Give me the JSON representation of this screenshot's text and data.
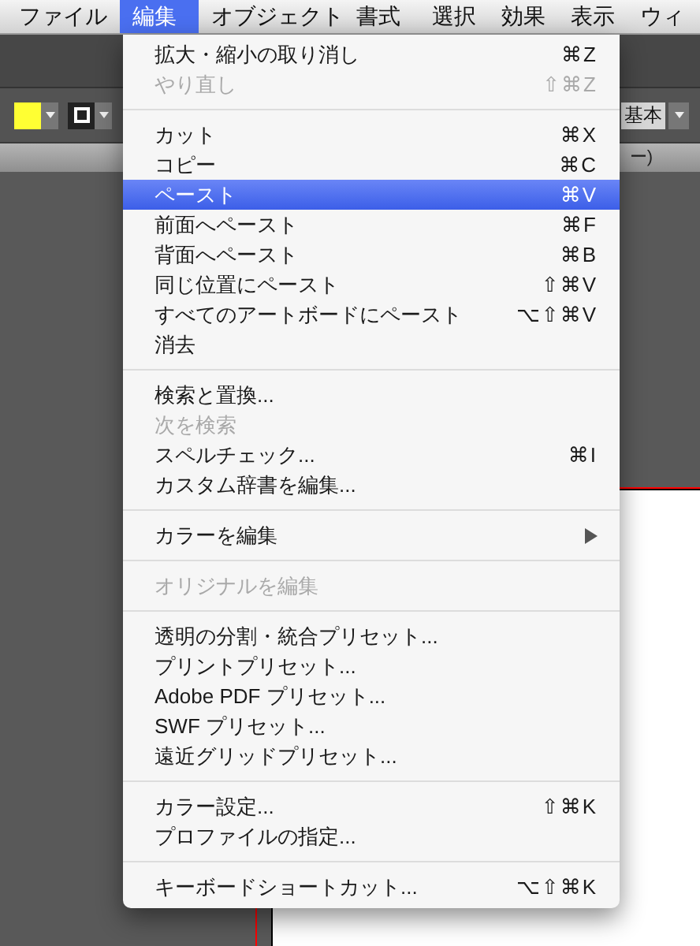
{
  "menubar": [
    {
      "label": "ファイル",
      "selected": false
    },
    {
      "label": "編集",
      "selected": true
    },
    {
      "label": "オブジェクト",
      "selected": false
    },
    {
      "label": "書式",
      "selected": false
    },
    {
      "label": "選択",
      "selected": false
    },
    {
      "label": "効果",
      "selected": false
    },
    {
      "label": "表示",
      "selected": false
    },
    {
      "label": "ウィ",
      "selected": false
    }
  ],
  "control_bar": {
    "fill_swatch": {
      "color": "#ffff33"
    },
    "workspace": "基本"
  },
  "document_tab": {
    "title": "ー)"
  },
  "menu": {
    "groups": [
      [
        {
          "label": "拡大・縮小の取り消し",
          "shortcut": "⌘Z",
          "disabled": false,
          "selected": false
        },
        {
          "label": "やり直し",
          "shortcut": "⇧⌘Z",
          "disabled": true,
          "selected": false
        }
      ],
      [
        {
          "label": "カット",
          "shortcut": "⌘X",
          "disabled": false,
          "selected": false
        },
        {
          "label": "コピー",
          "shortcut": "⌘C",
          "disabled": false,
          "selected": false
        },
        {
          "label": "ペースト",
          "shortcut": "⌘V",
          "disabled": false,
          "selected": true
        },
        {
          "label": "前面へペースト",
          "shortcut": "⌘F",
          "disabled": false,
          "selected": false
        },
        {
          "label": "背面へペースト",
          "shortcut": "⌘B",
          "disabled": false,
          "selected": false
        },
        {
          "label": "同じ位置にペースト",
          "shortcut": "⇧⌘V",
          "disabled": false,
          "selected": false
        },
        {
          "label": "すべてのアートボードにペースト",
          "shortcut": "⌥⇧⌘V",
          "disabled": false,
          "selected": false
        },
        {
          "label": "消去",
          "disabled": false,
          "selected": false
        }
      ],
      [
        {
          "label": "検索と置換...",
          "disabled": false,
          "selected": false
        },
        {
          "label": "次を検索",
          "disabled": true,
          "selected": false
        },
        {
          "label": "スペルチェック...",
          "shortcut": "⌘I",
          "disabled": false,
          "selected": false
        },
        {
          "label": "カスタム辞書を編集...",
          "disabled": false,
          "selected": false
        }
      ],
      [
        {
          "label": "カラーを編集",
          "disabled": false,
          "selected": false,
          "submenu": true
        }
      ],
      [
        {
          "label": "オリジナルを編集",
          "disabled": true,
          "selected": false
        }
      ],
      [
        {
          "label": "透明の分割・統合プリセット...",
          "disabled": false,
          "selected": false
        },
        {
          "label": "プリントプリセット...",
          "disabled": false,
          "selected": false
        },
        {
          "label": "Adobe PDF プリセット...",
          "disabled": false,
          "selected": false
        },
        {
          "label": "SWF プリセット...",
          "disabled": false,
          "selected": false
        },
        {
          "label": "遠近グリッドプリセット...",
          "disabled": false,
          "selected": false
        }
      ],
      [
        {
          "label": "カラー設定...",
          "shortcut": "⇧⌘K",
          "disabled": false,
          "selected": false
        },
        {
          "label": "プロファイルの指定...",
          "disabled": false,
          "selected": false
        }
      ],
      [
        {
          "label": "キーボードショートカット...",
          "shortcut": "⌥⇧⌘K",
          "disabled": false,
          "selected": false
        }
      ]
    ]
  }
}
